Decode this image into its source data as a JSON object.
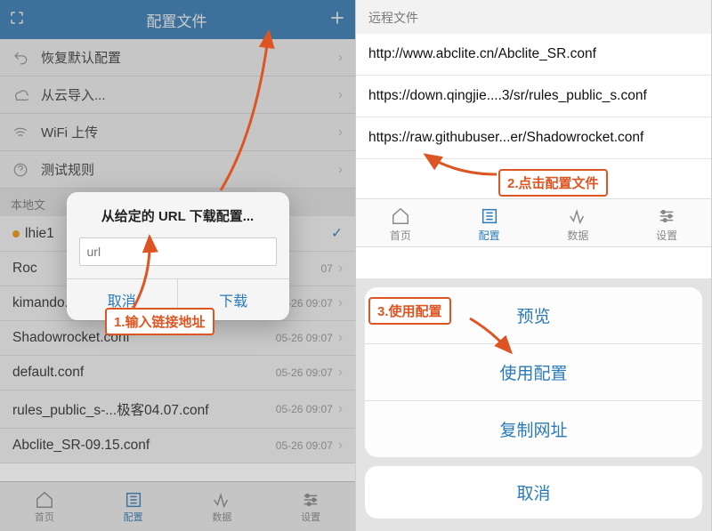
{
  "left": {
    "header": {
      "title": "配置文件"
    },
    "menu": [
      {
        "label": "恢复默认配置",
        "icon": "undo-icon"
      },
      {
        "label": "从云导入...",
        "icon": "cloud-icon"
      },
      {
        "label": "WiFi 上传",
        "icon": "wifi-icon"
      },
      {
        "label": "测试规则",
        "icon": "help-icon"
      }
    ],
    "local_header": "本地文",
    "files": [
      {
        "name": "lhie1",
        "ts": "",
        "active": true,
        "check": true
      },
      {
        "name": "Roc",
        "ts": "07",
        "active": false
      },
      {
        "name": "kimando.conf",
        "ts": "05-26 09:07",
        "active": false
      },
      {
        "name": "Shadowrocket.conf",
        "ts": "05-26 09:07",
        "active": false
      },
      {
        "name": "default.conf",
        "ts": "05-26 09:07",
        "active": false
      },
      {
        "name": "rules_public_s-...极客04.07.conf",
        "ts": "05-26 09:07",
        "active": false
      },
      {
        "name": "Abclite_SR-09.15.conf",
        "ts": "05-26 09:07",
        "active": false
      }
    ],
    "modal": {
      "title": "从给定的 URL 下载配置...",
      "placeholder": "url",
      "cancel": "取消",
      "download": "下载"
    },
    "tabs": [
      "首页",
      "配置",
      "数据",
      "设置"
    ],
    "annotation1": "1.输入链接地址"
  },
  "right": {
    "remote_header": "远程文件",
    "urls": [
      "http://www.abclite.cn/Abclite_SR.conf",
      "https://down.qingjie....3/sr/rules_public_s.conf",
      "https://raw.githubuser...er/Shadowrocket.conf"
    ],
    "tabs": [
      "首页",
      "配置",
      "数据",
      "设置"
    ],
    "sheet": {
      "preview": "预览",
      "use": "使用配置",
      "copy": "复制网址",
      "cancel": "取消"
    },
    "annotation2": "2.点击配置文件",
    "annotation3": "3.使用配置"
  }
}
